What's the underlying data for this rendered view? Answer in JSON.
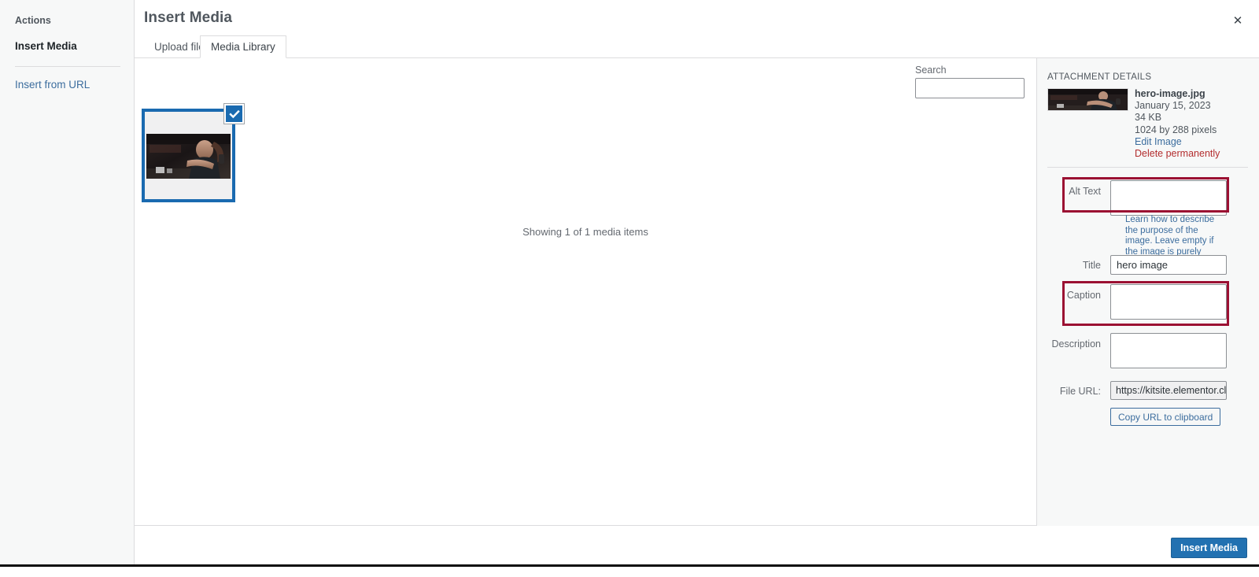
{
  "sidebar": {
    "heading": "Actions",
    "active_item": "Insert Media",
    "link": "Insert from URL"
  },
  "header": {
    "title": "Insert Media",
    "close_icon": "close-icon"
  },
  "tabs": [
    {
      "label": "Upload files",
      "active": false
    },
    {
      "label": "Media Library",
      "active": true
    }
  ],
  "search": {
    "label": "Search",
    "value": "",
    "placeholder": ""
  },
  "library": {
    "status_text": "Showing 1 of 1 media items",
    "item_selected": true,
    "check_icon": "checkmark-icon"
  },
  "details": {
    "panel_title": "ATTACHMENT DETAILS",
    "filename": "hero-image.jpg",
    "date": "January 15, 2023",
    "filesize": "34 KB",
    "dimensions": "1024 by 288 pixels",
    "edit_link": "Edit Image",
    "delete_link": "Delete permanently",
    "fields": {
      "alt_text_label": "Alt Text",
      "alt_text_value": "",
      "alt_helper": "Learn how to describe the purpose of the image. Leave empty if the image is purely decorative.",
      "title_label": "Title",
      "title_value": "hero image",
      "caption_label": "Caption",
      "caption_value": "",
      "description_label": "Description",
      "description_value": "",
      "file_url_label": "File URL:",
      "file_url_value": "https://kitsite.elementor.clc",
      "copy_button": "Copy URL to clipboard"
    }
  },
  "footer": {
    "insert_button": "Insert Media"
  },
  "colors": {
    "accent_blue": "#2271b1",
    "selection_blue": "#1a6ab0",
    "annotation_red": "#9b1032",
    "delete_red": "#b32d2e",
    "panel_bg": "#f7f8f8"
  }
}
